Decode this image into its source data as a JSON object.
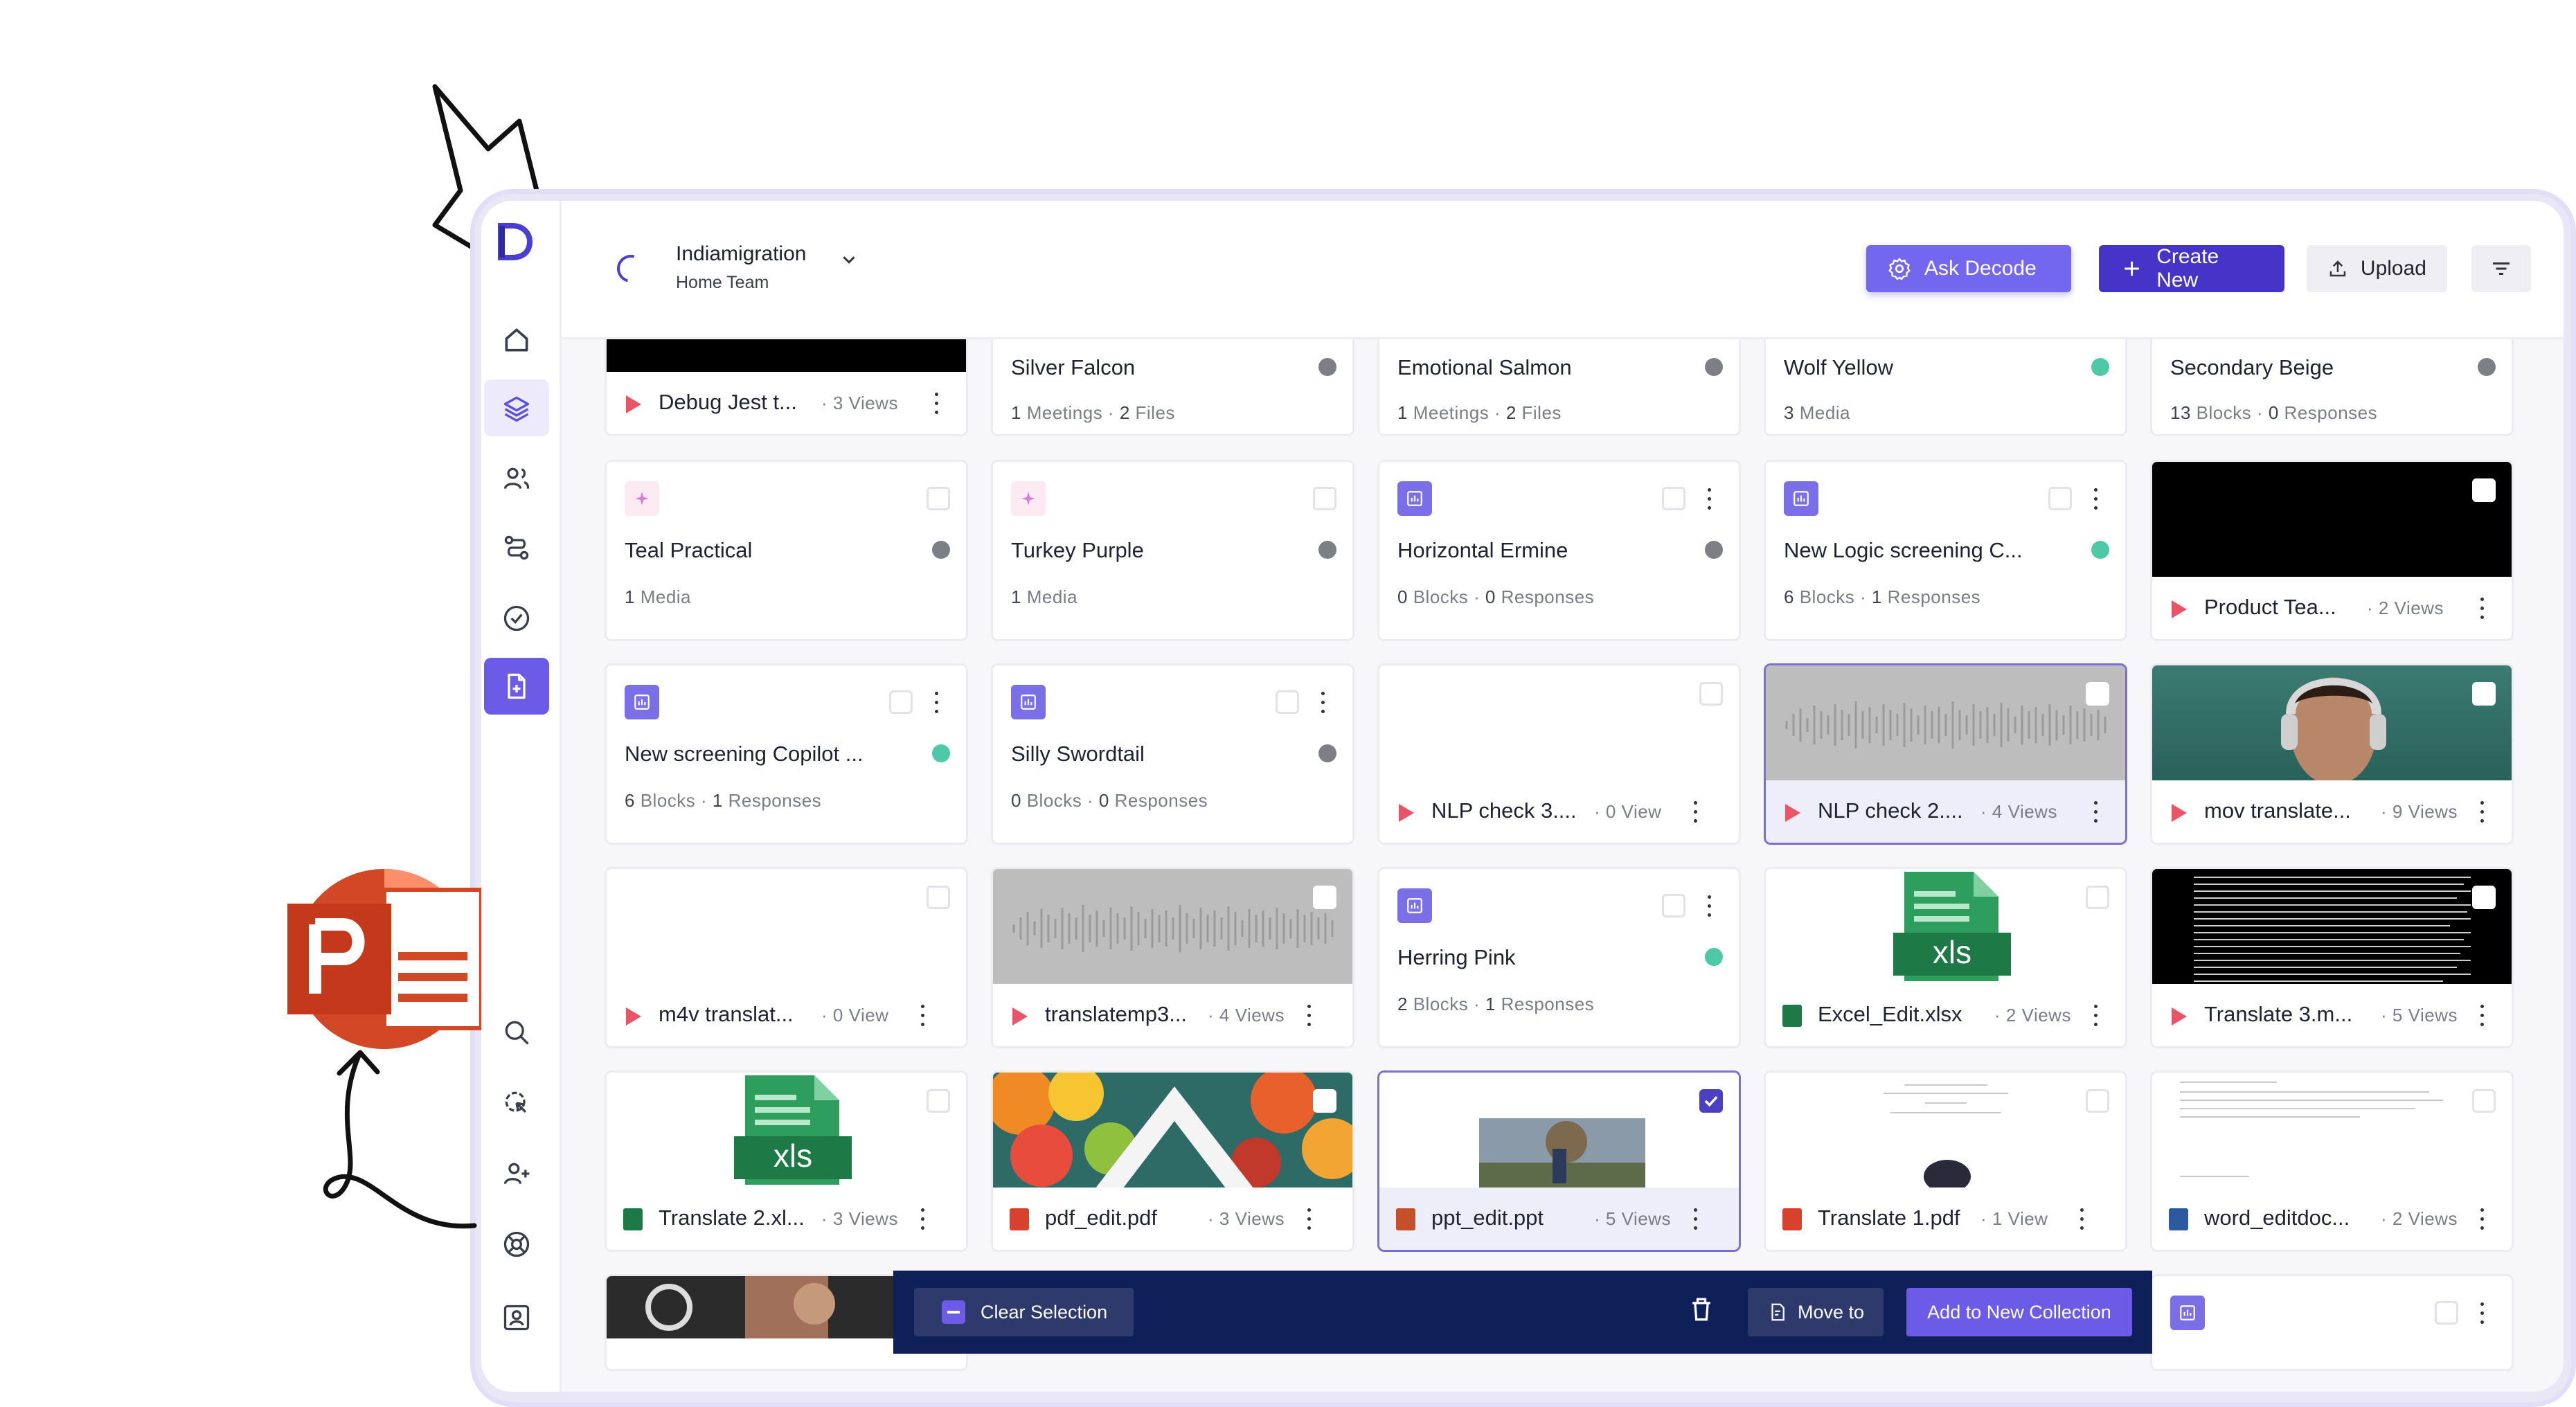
{
  "header": {
    "workspace_name": "Indiamigration",
    "workspace_team": "Home Team",
    "ask_label": "Ask Decode",
    "create_label": "Create New",
    "upload_label": "Upload"
  },
  "cards": [
    {
      "title": "Debug Jest t...",
      "meta": "3 Views"
    },
    {
      "title": "Silver Falcon",
      "m1": "1",
      "l1": "Meetings",
      "m2": "2",
      "l2": "Files"
    },
    {
      "title": "Emotional Salmon",
      "m1": "1",
      "l1": "Meetings",
      "m2": "2",
      "l2": "Files"
    },
    {
      "title": "Wolf Yellow",
      "m1": "3",
      "l1": "Media"
    },
    {
      "title": "Secondary Beige",
      "m1": "13",
      "l1": "Blocks",
      "m2": "0",
      "l2": "Responses"
    },
    {
      "title": "Teal Practical",
      "m1": "1",
      "l1": "Media"
    },
    {
      "title": "Turkey Purple",
      "m1": "1",
      "l1": "Media"
    },
    {
      "title": "Horizontal Ermine",
      "m1": "0",
      "l1": "Blocks",
      "m2": "0",
      "l2": "Responses"
    },
    {
      "title": "New Logic screening C...",
      "m1": "6",
      "l1": "Blocks",
      "m2": "1",
      "l2": "Responses"
    },
    {
      "title": "Product Tea...",
      "meta": "2 Views"
    },
    {
      "title": "New screening Copilot ...",
      "m1": "6",
      "l1": "Blocks",
      "m2": "1",
      "l2": "Responses"
    },
    {
      "title": "Silly Swordtail",
      "m1": "0",
      "l1": "Blocks",
      "m2": "0",
      "l2": "Responses"
    },
    {
      "title": "NLP check 3....",
      "meta": "0 View"
    },
    {
      "title": "NLP check 2....",
      "meta": "4 Views"
    },
    {
      "title": "mov translate...",
      "meta": "9 Views"
    },
    {
      "title": "m4v translat...",
      "meta": "0 View"
    },
    {
      "title": "translatemp3...",
      "meta": "4 Views"
    },
    {
      "title": "Herring Pink",
      "m1": "2",
      "l1": "Blocks",
      "m2": "1",
      "l2": "Responses"
    },
    {
      "title": "Excel_Edit.xlsx",
      "meta": "2 Views"
    },
    {
      "title": "Translate 3.m...",
      "meta": "5 Views"
    },
    {
      "title": "Translate 2.xl...",
      "meta": "3 Views"
    },
    {
      "title": "pdf_edit.pdf",
      "meta": "3 Views"
    },
    {
      "title": "ppt_edit.ppt",
      "meta": "5 Views"
    },
    {
      "title": "Translate 1.pdf",
      "meta": "1 View"
    },
    {
      "title": "word_editdoc...",
      "meta": "2 Views"
    }
  ],
  "thumb_text": {
    "xls": "xls"
  },
  "selection_bar": {
    "clear_label": "Clear Selection",
    "move_label": "Move to",
    "add_label": "Add to New Collection"
  },
  "colors": {
    "accent": "#6b5be6",
    "primary": "#4634c9",
    "bar": "#0f1f57",
    "teal": "#4ec9a8"
  }
}
